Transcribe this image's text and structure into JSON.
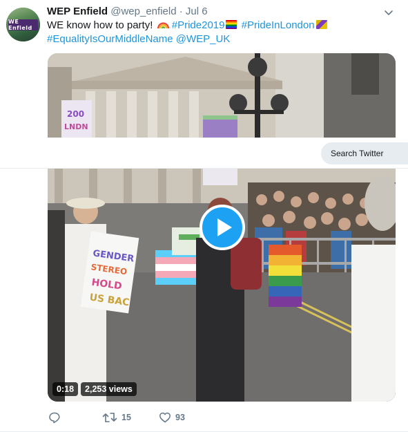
{
  "tweet": {
    "author_name": "WEP Enfield",
    "handle": "@wep_enfield",
    "separator": "·",
    "date": "Jul 6",
    "avatar_text": "WE Enfield",
    "text_line1_start": "WE know how to party!",
    "hashtag_pride2019": "#Pride2019",
    "hashtag_pride_in_london": "#PrideInLondon",
    "hashtag_equality": "#EqualityIsOurMiddleName",
    "mention_wep_uk": "@WEP_UK"
  },
  "video": {
    "duration": "0:18",
    "views": "2,253 views"
  },
  "actions": {
    "reply_count": "",
    "retweet_count": "15",
    "like_count": "93"
  },
  "search": {
    "placeholder": "Search Twitter"
  },
  "colors": {
    "link": "#1b95e0",
    "play_button": "#1da1f2",
    "muted_text": "#657786"
  },
  "icons": [
    "chevron-down-icon",
    "rainbow-icon",
    "rainbow-flag-icon",
    "play-icon",
    "reply-icon",
    "retweet-icon",
    "like-icon"
  ]
}
